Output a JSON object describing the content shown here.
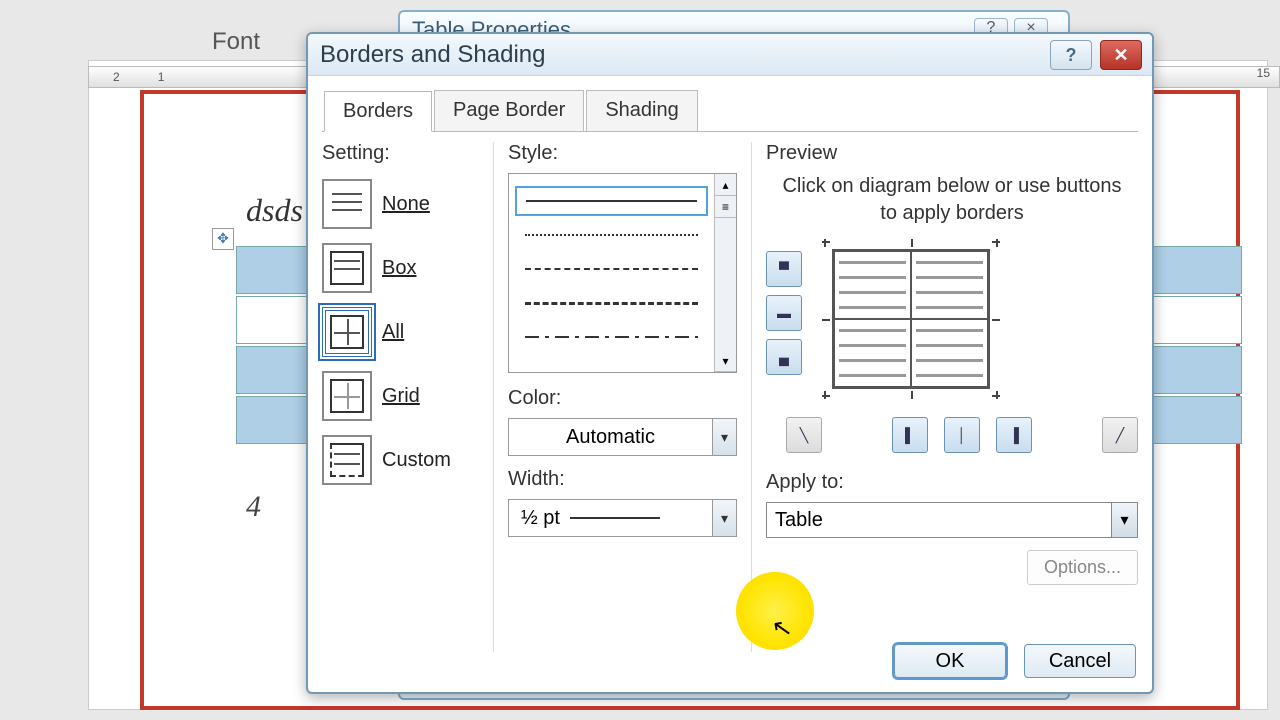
{
  "background": {
    "font_group_label": "Font",
    "doc_text": "dsds",
    "doc_num": "4",
    "ruler_left": [
      "2",
      "1"
    ],
    "ruler_right": [
      "15"
    ]
  },
  "parent_dialog": {
    "title": "Table Properties",
    "help": "?",
    "close": "×"
  },
  "dialog": {
    "title": "Borders and Shading",
    "help": "?",
    "close": "✕",
    "tabs": {
      "borders": "Borders",
      "page_border": "Page Border",
      "shading": "Shading"
    },
    "setting": {
      "label": "Setting:",
      "none": "None",
      "box": "Box",
      "all": "All",
      "grid": "Grid",
      "custom": "Custom"
    },
    "style": {
      "label": "Style:",
      "color_label": "Color:",
      "color_value": "Automatic",
      "width_label": "Width:",
      "width_value": "½ pt"
    },
    "preview": {
      "label": "Preview",
      "hint": "Click on diagram below or use buttons to apply borders",
      "apply_label": "Apply to:",
      "apply_value": "Table",
      "options": "Options..."
    },
    "buttons": {
      "ok": "OK",
      "cancel": "Cancel"
    }
  }
}
